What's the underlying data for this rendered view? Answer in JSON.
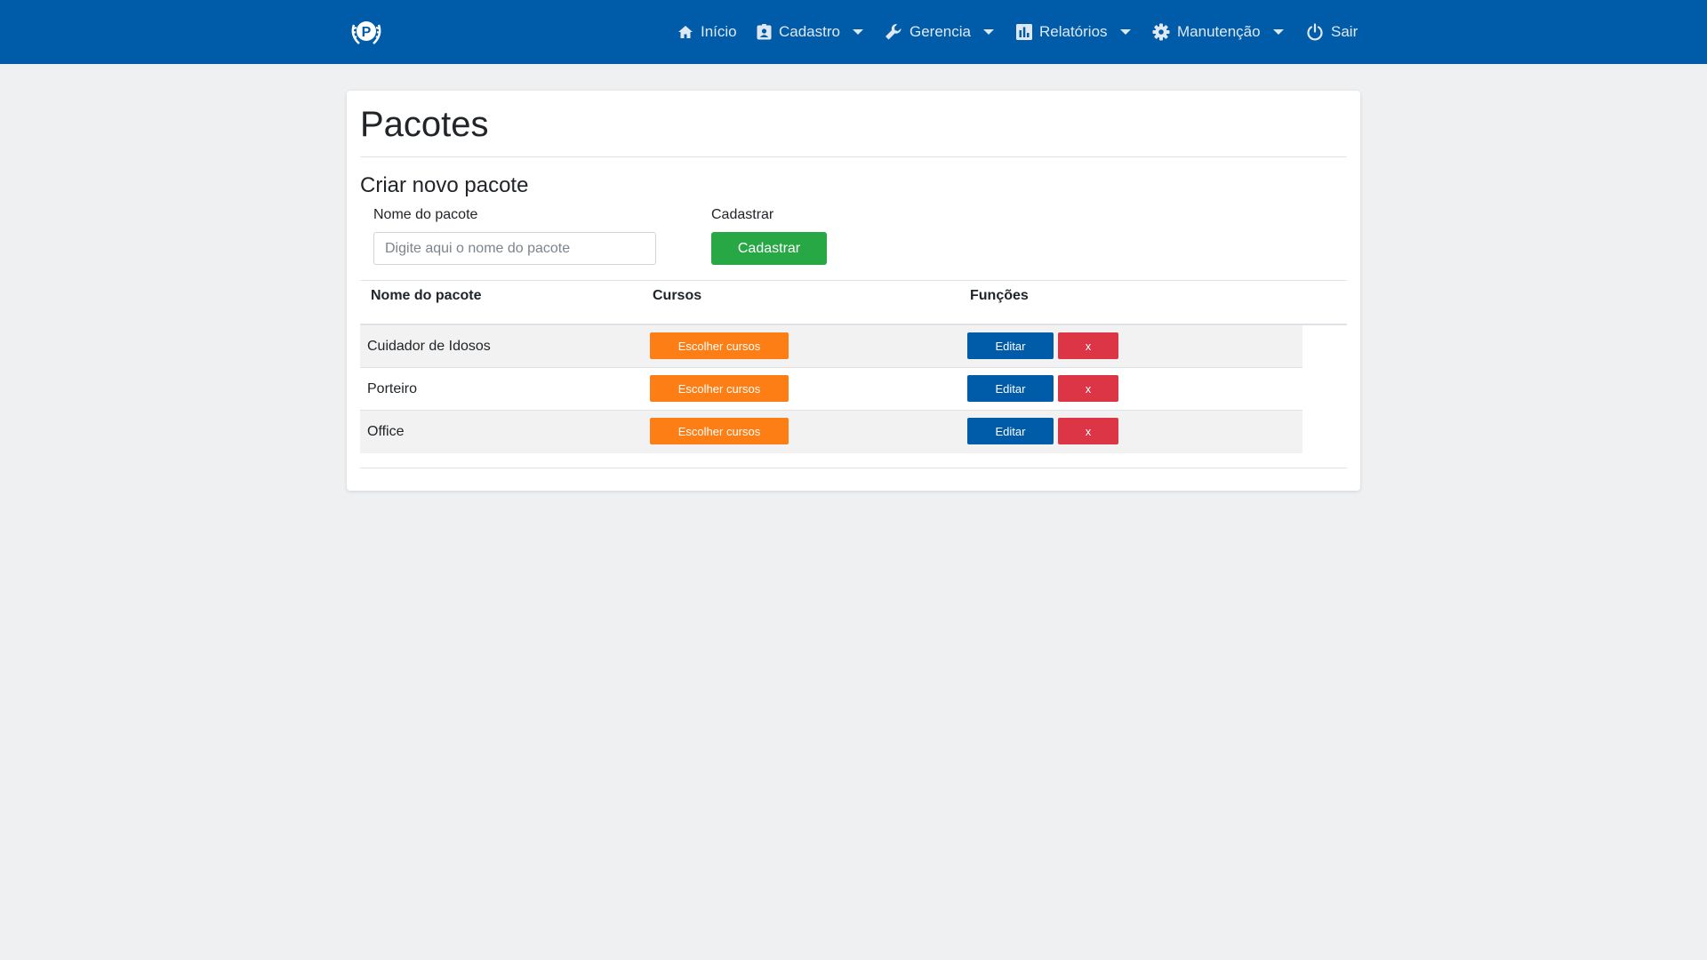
{
  "nav": {
    "items": [
      {
        "label": "Início",
        "icon": "home-icon"
      },
      {
        "label": "Cadastro",
        "icon": "id-card-icon"
      },
      {
        "label": "Gerencia",
        "icon": "wrench-icon"
      },
      {
        "label": "Relatórios",
        "icon": "bar-chart-icon"
      },
      {
        "label": "Manutenção",
        "icon": "gear-icon"
      },
      {
        "label": "Sair",
        "icon": "power-icon"
      }
    ]
  },
  "page": {
    "title": "Pacotes",
    "form_title": "Criar novo pacote",
    "name_label": "Nome do pacote",
    "name_placeholder": "Digite aqui o nome do pacote",
    "submit_label": "Cadastrar",
    "submit_button": "Cadastrar"
  },
  "table": {
    "headers": [
      "Nome do pacote",
      "Cursos",
      "Funções"
    ],
    "rows": [
      {
        "name": "Cuidador de Idosos",
        "courses_button": "Escolher cursos",
        "edit_button": "Editar",
        "delete_button": "x"
      },
      {
        "name": "Porteiro",
        "courses_button": "Escolher cursos",
        "edit_button": "Editar",
        "delete_button": "x"
      },
      {
        "name": "Office",
        "courses_button": "Escolher cursos",
        "edit_button": "Editar",
        "delete_button": "x"
      }
    ]
  },
  "colors": {
    "topbar": "#005ca8",
    "background": "#eef0f2",
    "green": "#28a745",
    "orange": "#fd7e14",
    "blue": "#005ca8",
    "red": "#dc3545"
  }
}
